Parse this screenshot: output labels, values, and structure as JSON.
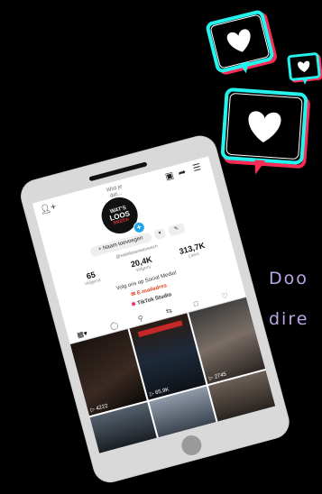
{
  "deco": {
    "text_line_1": "Doo",
    "text_line_2": "dire"
  },
  "profile": {
    "avatar_label": "Wist je dat...",
    "avatar_brand_line1": "WAT'S",
    "avatar_brand_line2": "LOOS",
    "avatar_brand_line3": "BREDA",
    "name_button": "+ Naam toevoegen",
    "handle": "@watsloosmetvreech",
    "stats": [
      {
        "value": "65",
        "label": "Volgend"
      },
      {
        "value": "20,4K",
        "label": "Volgers"
      },
      {
        "value": "313,7K",
        "label": "Likes"
      }
    ],
    "bio": "Volg ons op Social Media!",
    "email": "E-mailadres",
    "studio": "TikTok Studio",
    "videos": [
      {
        "views": "4222"
      },
      {
        "views": "65,9K"
      },
      {
        "views": "2745"
      },
      {
        "views": ""
      },
      {
        "views": ""
      },
      {
        "views": ""
      }
    ]
  },
  "colors": {
    "background": "#000000",
    "text_purple": "#b9a6e6",
    "tiktok_cyan": "#25f4ee",
    "tiktok_red": "#fe2c55",
    "badge_blue": "#20a6e8"
  }
}
